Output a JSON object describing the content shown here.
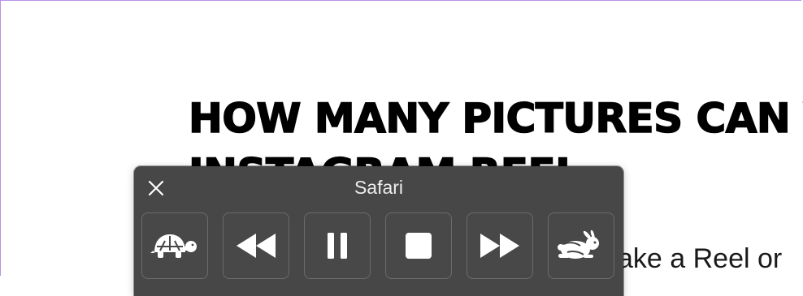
{
  "article": {
    "heading_line1": "HOW MANY PICTURES CAN Y",
    "heading_line2": "INSTAGRAM REEL",
    "body_partial": "ake a Reel or"
  },
  "panel": {
    "title": "Safari",
    "buttons": [
      {
        "icon": "turtle-icon",
        "label": "Slow down"
      },
      {
        "icon": "rewind-icon",
        "label": "Rewind"
      },
      {
        "icon": "pause-icon",
        "label": "Pause"
      },
      {
        "icon": "stop-icon",
        "label": "Stop"
      },
      {
        "icon": "fast-forward-icon",
        "label": "Fast forward"
      },
      {
        "icon": "rabbit-icon",
        "label": "Speed up"
      }
    ]
  },
  "colors": {
    "panel_bg": "#474747",
    "panel_border": "#6b6b6b",
    "icon_fill": "#ffffff",
    "frame_accent": "#b991e6"
  }
}
